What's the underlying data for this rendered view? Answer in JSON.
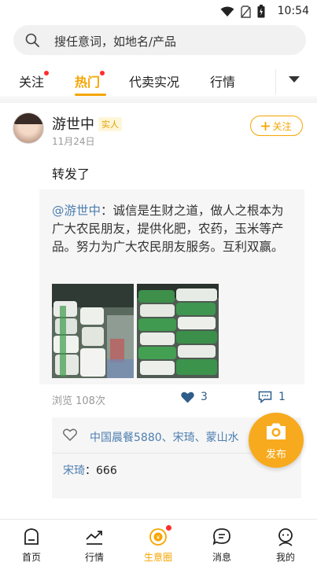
{
  "status_bar": {
    "time": "10:54"
  },
  "search": {
    "placeholder": "搜任意词，如地名/产品"
  },
  "tabs": [
    {
      "label": "关注",
      "has_dot": true
    },
    {
      "label": "热门",
      "has_dot": true,
      "active": true
    },
    {
      "label": "代卖实况"
    },
    {
      "label": "行情"
    }
  ],
  "post": {
    "user_name": "游世中",
    "badge": "实人",
    "date": "11月24日",
    "follow_label": "关注",
    "text": "转发了",
    "quote": {
      "mention": "@游世中",
      "body": "：诚信是生财之道，做人之根本为广大农民朋友，提供化肥，农药，玉米等产品。努力为广大农民朋友服务。互利双赢。"
    },
    "views": "浏览 108次",
    "likes_count": "3",
    "comments_count": "1",
    "liked_by": "中国晨餐5880、宋琦、蒙山水",
    "comment": {
      "author": "宋琦",
      "text": "666"
    }
  },
  "fab": {
    "label": "发布"
  },
  "bottom_nav": [
    {
      "label": "首页"
    },
    {
      "label": "行情"
    },
    {
      "label": "生意圈",
      "active": true
    },
    {
      "label": "消息"
    },
    {
      "label": "我的"
    }
  ],
  "colors": {
    "accent": "#f5a500",
    "link": "#4d7eb0",
    "badge_red": "#ff2d2d"
  }
}
